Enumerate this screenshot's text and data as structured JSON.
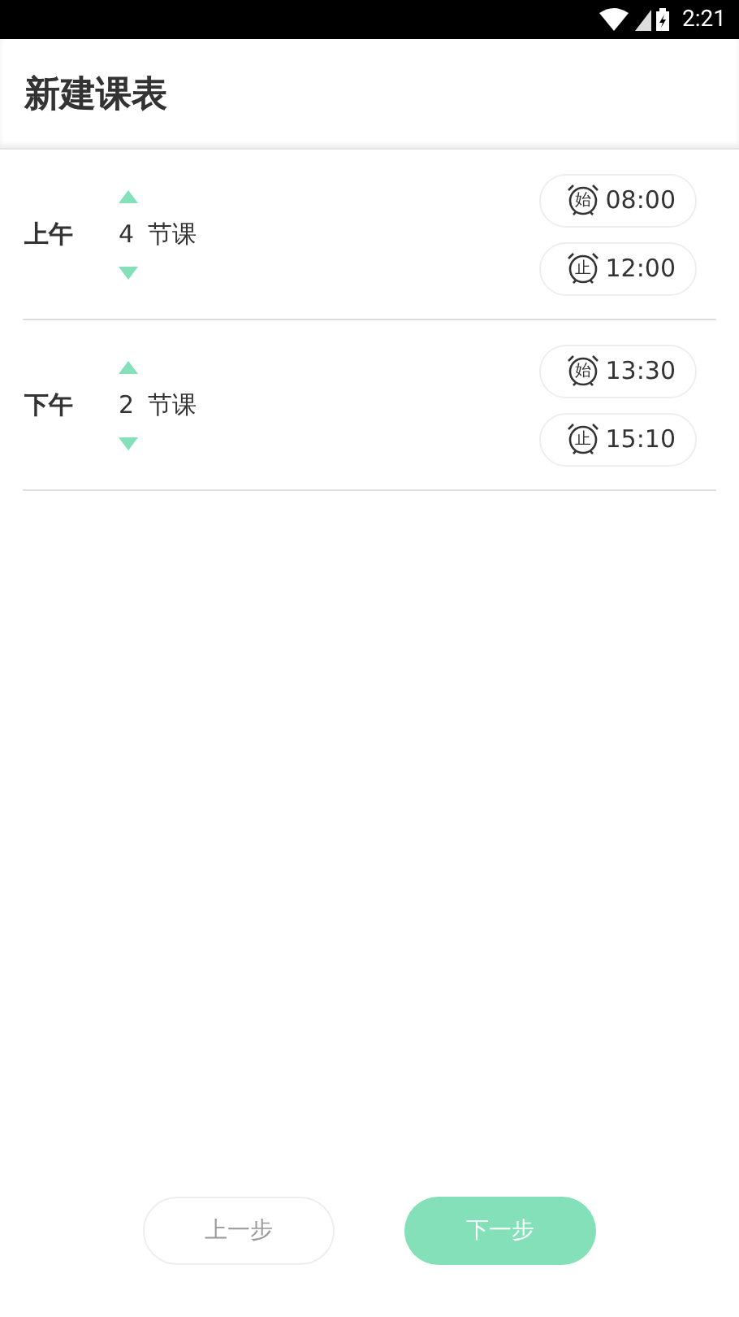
{
  "status_bar": {
    "time": "2:21"
  },
  "title": "新建课表",
  "sessions": [
    {
      "label": "上午",
      "count": "4",
      "unit": "节课",
      "times": [
        {
          "mark": "始",
          "time": "08:00"
        },
        {
          "mark": "止",
          "time": "12:00"
        }
      ]
    },
    {
      "label": "下午",
      "count": "2",
      "unit": "节课",
      "times": [
        {
          "mark": "始",
          "time": "13:30"
        },
        {
          "mark": "止",
          "time": "15:10"
        }
      ]
    }
  ],
  "buttons": [
    {
      "label": "上一步",
      "kind": "secondary"
    },
    {
      "label": "下一步",
      "kind": "primary"
    }
  ]
}
